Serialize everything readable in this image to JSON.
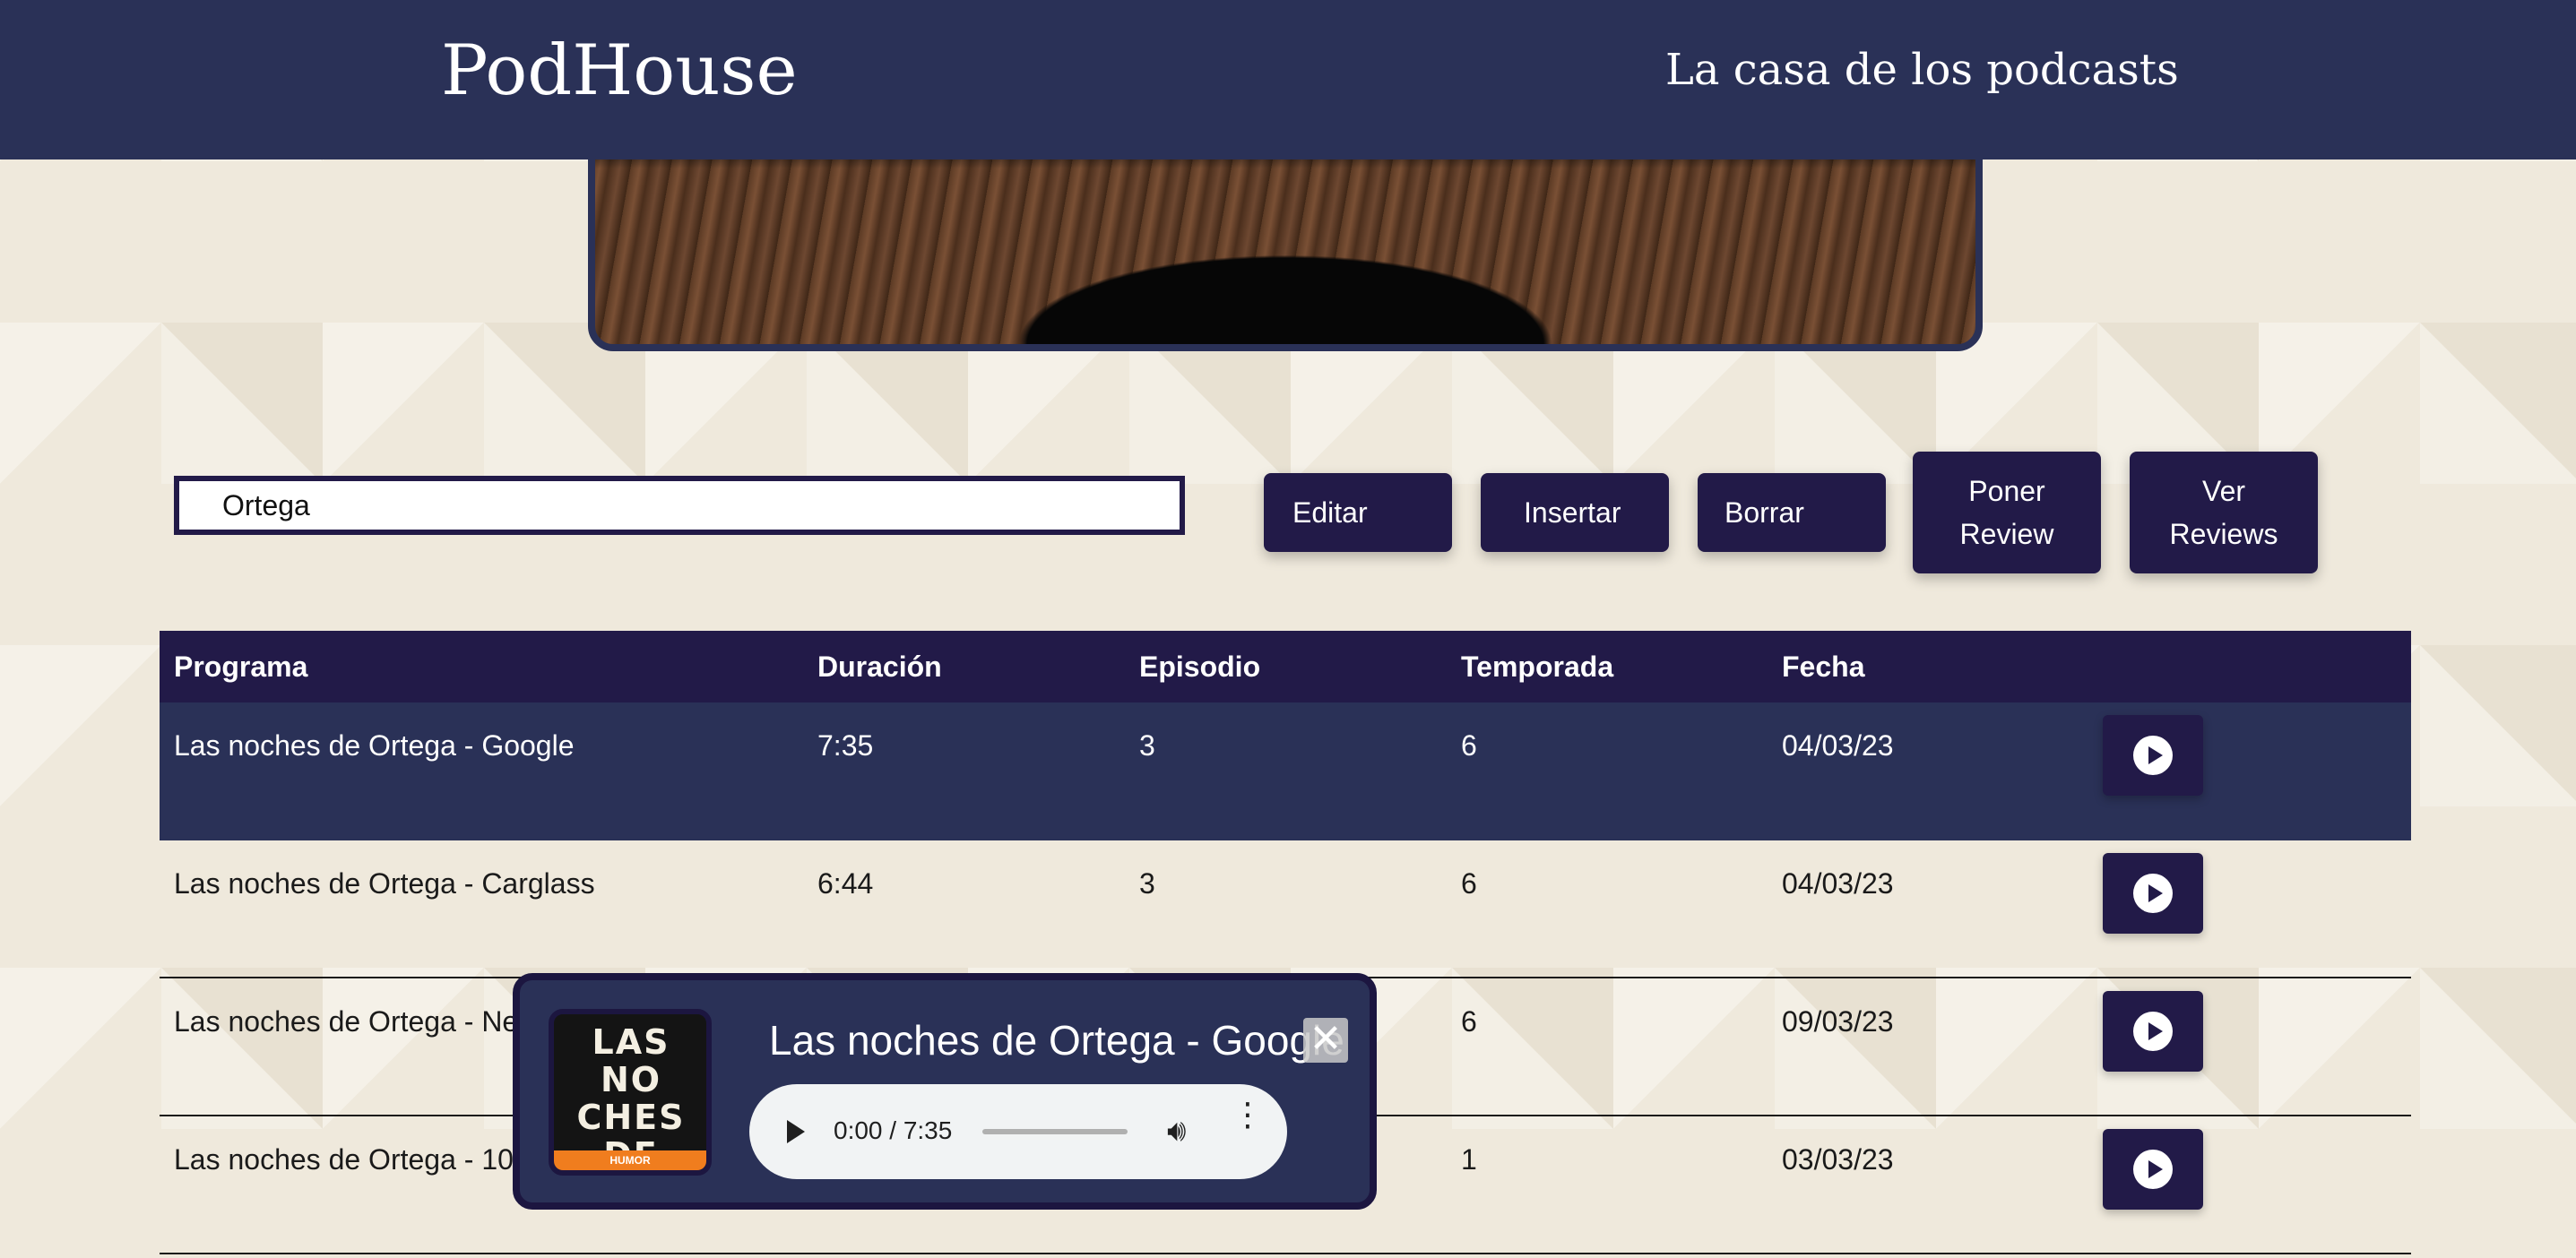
{
  "header": {
    "brand": "PodHouse",
    "tagline": "La casa de los podcasts"
  },
  "search": {
    "value": "Ortega"
  },
  "toolbar": {
    "edit_label": "Editar",
    "insert_label": "Insertar",
    "delete_label": "Borrar",
    "add_review_label": "Poner Review",
    "view_reviews_label": "Ver Reviews"
  },
  "table": {
    "columns": [
      "Programa",
      "Duración",
      "Episodio",
      "Temporada",
      "Fecha"
    ],
    "rows": [
      {
        "programa": "Las noches de Ortega - Google",
        "duracion": "7:35",
        "episodio": "3",
        "temporada": "6",
        "fecha": "04/03/23",
        "selected": true
      },
      {
        "programa": "Las noches de Ortega - Carglass",
        "duracion": "6:44",
        "episodio": "3",
        "temporada": "6",
        "fecha": "04/03/23",
        "selected": false
      },
      {
        "programa": "Las noches de Ortega - Ne",
        "duracion": "",
        "episodio": "",
        "temporada": "6",
        "fecha": "09/03/23",
        "selected": false
      },
      {
        "programa": "Las noches de Ortega - 10",
        "duracion": "",
        "episodio": "",
        "temporada": "1",
        "fecha": "03/03/23",
        "selected": false
      }
    ]
  },
  "player": {
    "title": "Las noches de Ortega - Google",
    "cover_text": "LAS NO CHES DE ORTEGA",
    "cover_band": "HUMOR",
    "time": "0:00 / 7:35",
    "close_glyph": "✕",
    "volume_icon": "speaker-icon",
    "more_icon": "more-vertical-icon"
  },
  "colors": {
    "header_bg": "#2a3157",
    "accent": "#221a48",
    "page_bg": "#efe9dc"
  }
}
